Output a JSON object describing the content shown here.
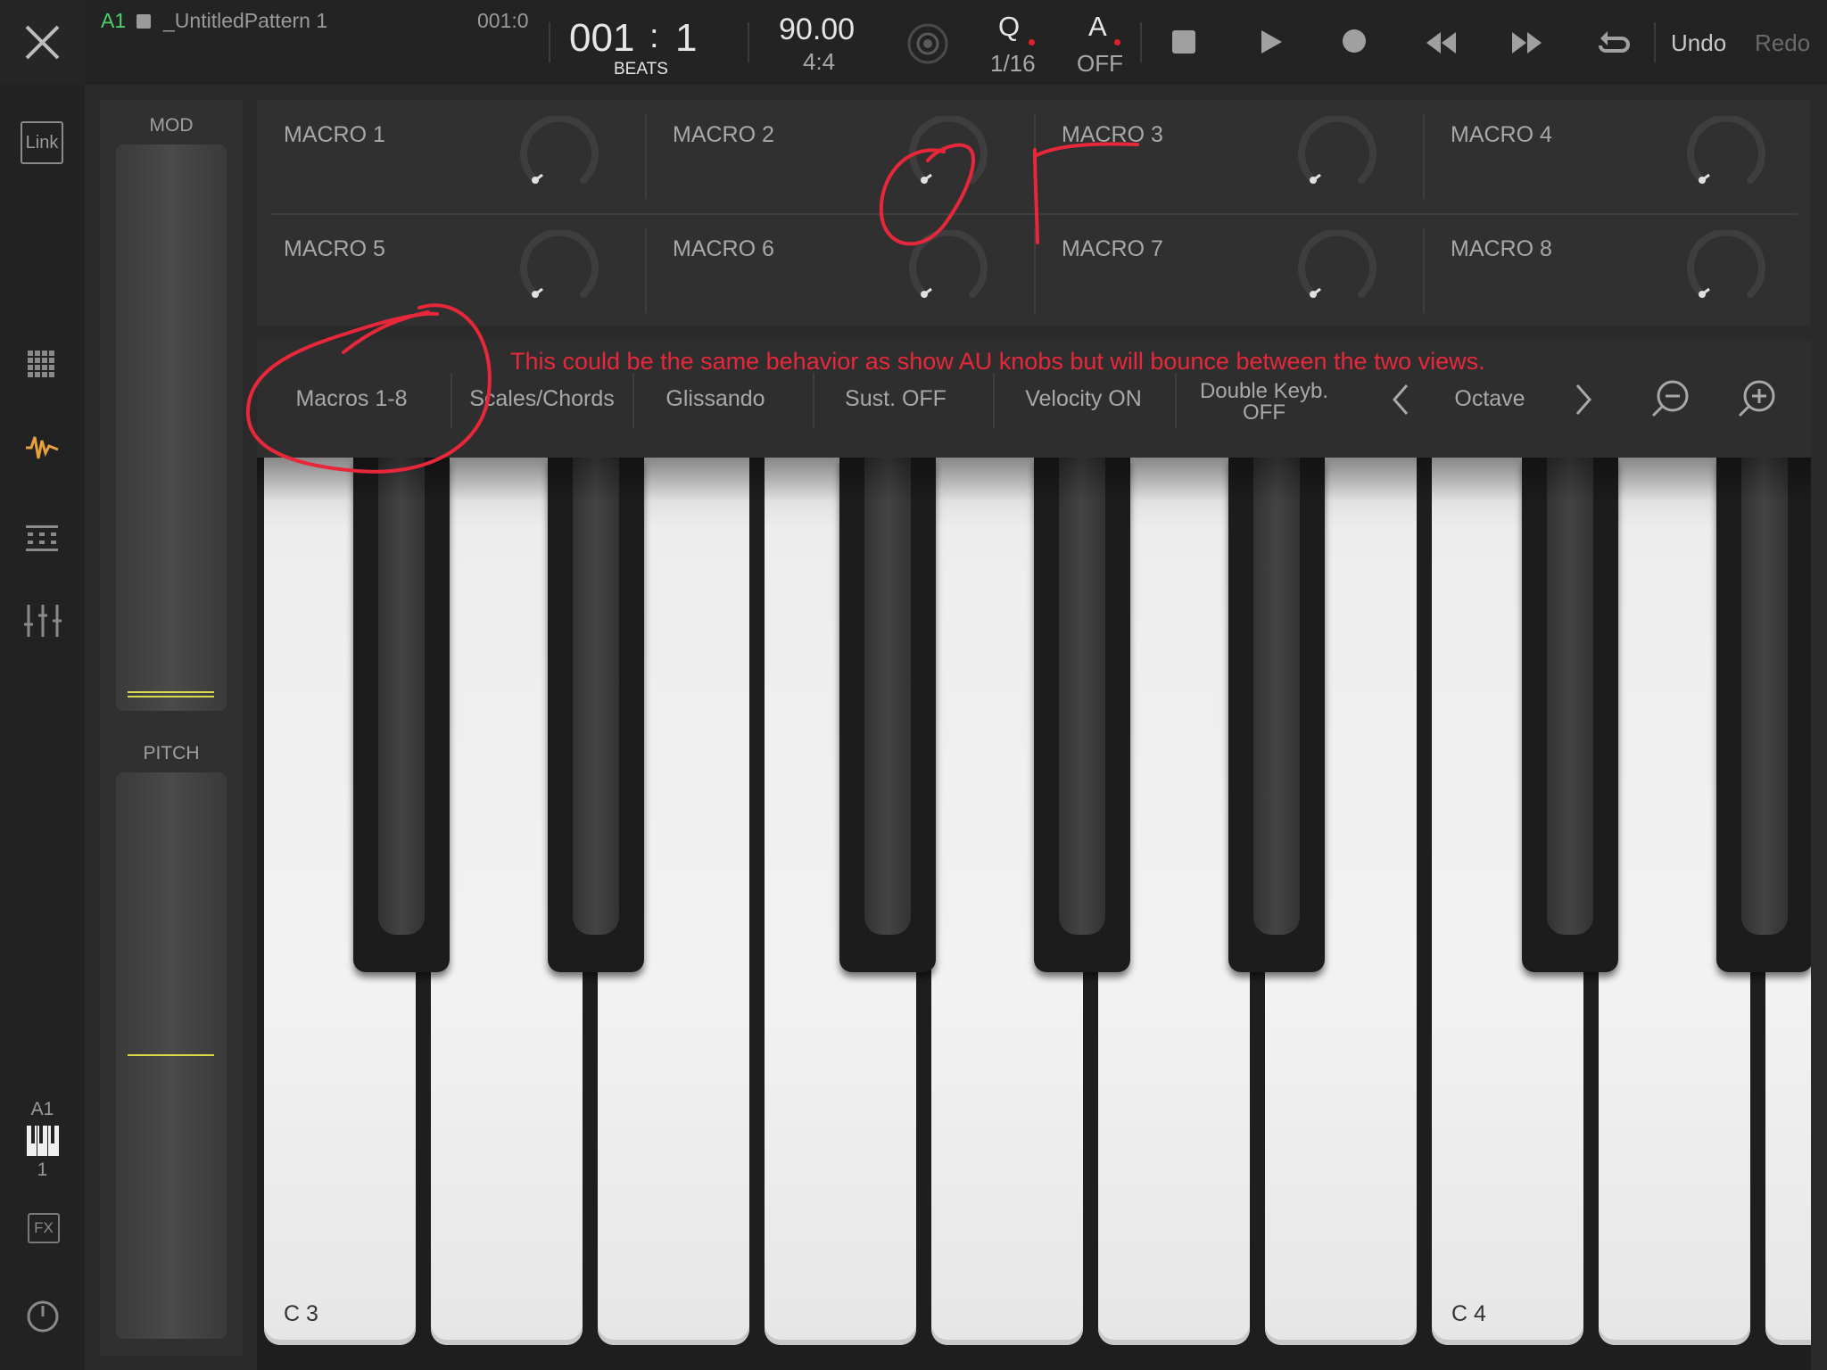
{
  "header": {
    "track_id": "A1",
    "pattern_name": "_UntitledPattern 1",
    "position_small": "001:0",
    "position_bar": "001",
    "position_colon": ":",
    "position_beat": "1",
    "position_unit": "BEATS",
    "tempo": "90.00",
    "time_signature": "4:4",
    "quantize_label": "Q",
    "quantize_value": "1/16",
    "automation_label": "A",
    "automation_value": "OFF",
    "undo_label": "Undo",
    "redo_label": "Redo"
  },
  "sidebar": {
    "link_label": "Link",
    "track_label": "A1",
    "track_number": "1",
    "fx_label": "FX",
    "accent_color": "#e8a13a"
  },
  "left_panel": {
    "mod_label": "MOD",
    "pitch_label": "PITCH",
    "indicator_color": "#d9d94a"
  },
  "macros": [
    {
      "label": "MACRO 1"
    },
    {
      "label": "MACRO 2"
    },
    {
      "label": "MACRO 3"
    },
    {
      "label": "MACRO 4"
    },
    {
      "label": "MACRO 5"
    },
    {
      "label": "MACRO 6"
    },
    {
      "label": "MACRO 7"
    },
    {
      "label": "MACRO 8"
    }
  ],
  "toolbar": {
    "macros": "Macros 1-8",
    "scales": "Scales/Chords",
    "glissando": "Glissando",
    "sustain": "Sust. OFF",
    "velocity": "Velocity ON",
    "double_line1": "Double Keyb.",
    "double_line2": "OFF",
    "octave": "Octave"
  },
  "annotation": {
    "text": "This could be the same behavior as show AU knobs but will bounce between the two views.",
    "or_text": "or",
    "color": "#e8283a"
  },
  "keyboard": {
    "c3_label": "C 3",
    "c4_label": "C 4"
  }
}
